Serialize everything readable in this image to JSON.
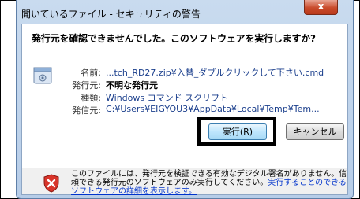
{
  "window": {
    "title": "開いているファイル - セキュリティの警告",
    "close_glyph": "x"
  },
  "dialog": {
    "heading": "発行元を確認できませんでした。このソフトウェアを実行しますか?",
    "file_info": [
      {
        "label": "名前:",
        "value": "...tch_RD27.zip¥入替_ダブルクリックして下さい.cmd",
        "style": "blue"
      },
      {
        "label": "発行元:",
        "value": "不明な発行元",
        "style": "bold"
      },
      {
        "label": "種類:",
        "value": "Windows コマンド スクリプト",
        "style": "blue"
      },
      {
        "label": "発信元:",
        "value": "C:¥Users¥EIGYOU3¥AppData¥Local¥Temp¥Tem...",
        "style": "blue"
      }
    ],
    "buttons": {
      "run_label": "実行(R)",
      "cancel_label": "キャンセル"
    },
    "warning": {
      "text": "このファイルには、発行元を検証できる有効なデジタル署名がありません。信頼できる発行元のソフトウェアのみ実行してください。",
      "link_text": "実行することのできるソフトウェアの詳細を表示します。"
    }
  },
  "colors": {
    "frame_blue": "#b7cde8",
    "close_red": "#c94a2b",
    "link_blue": "#0033cc",
    "highlight_border": "#000000"
  },
  "icons": {
    "file": "application-file-icon",
    "shield": "security-shield-icon"
  }
}
